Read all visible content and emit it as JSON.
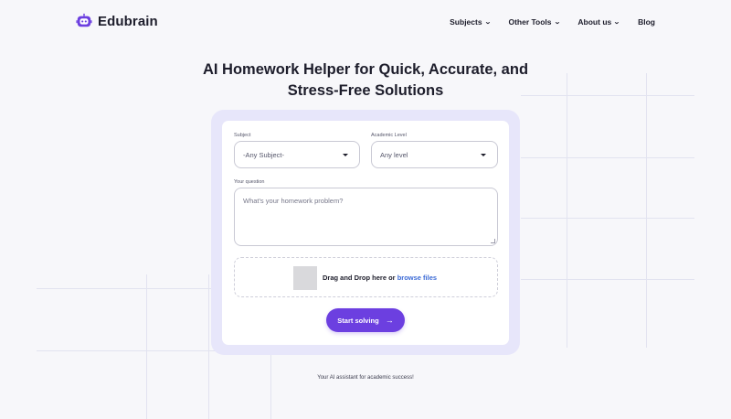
{
  "brand": {
    "name": "Edubrain",
    "icon": "robot-face-icon",
    "color": "#6c3fe0"
  },
  "nav": {
    "items": [
      {
        "label": "Subjects",
        "has_dropdown": true
      },
      {
        "label": "Other Tools",
        "has_dropdown": true
      },
      {
        "label": "About us",
        "has_dropdown": true
      },
      {
        "label": "Blog",
        "has_dropdown": false
      }
    ],
    "chevron": "⌄"
  },
  "hero": {
    "title_line1": "AI Homework Helper for Quick, Accurate, and",
    "title_line2": "Stress-Free Solutions"
  },
  "form": {
    "subject_label": "Subject",
    "subject_value": "-Any Subject-",
    "level_label": "Academic Level",
    "level_value": "Any level",
    "question_label": "Your question",
    "question_placeholder": "What's your homework problem?",
    "drop_text": "Drag and Drop here or ",
    "drop_link": "browse files",
    "submit_label": "Start solving",
    "submit_arrow": "→"
  },
  "tagline": "Your AI assistant for academic success!",
  "colors": {
    "accent": "#6c3fe0",
    "link": "#3d6bd6",
    "card_bg": "#e7e6fa"
  }
}
